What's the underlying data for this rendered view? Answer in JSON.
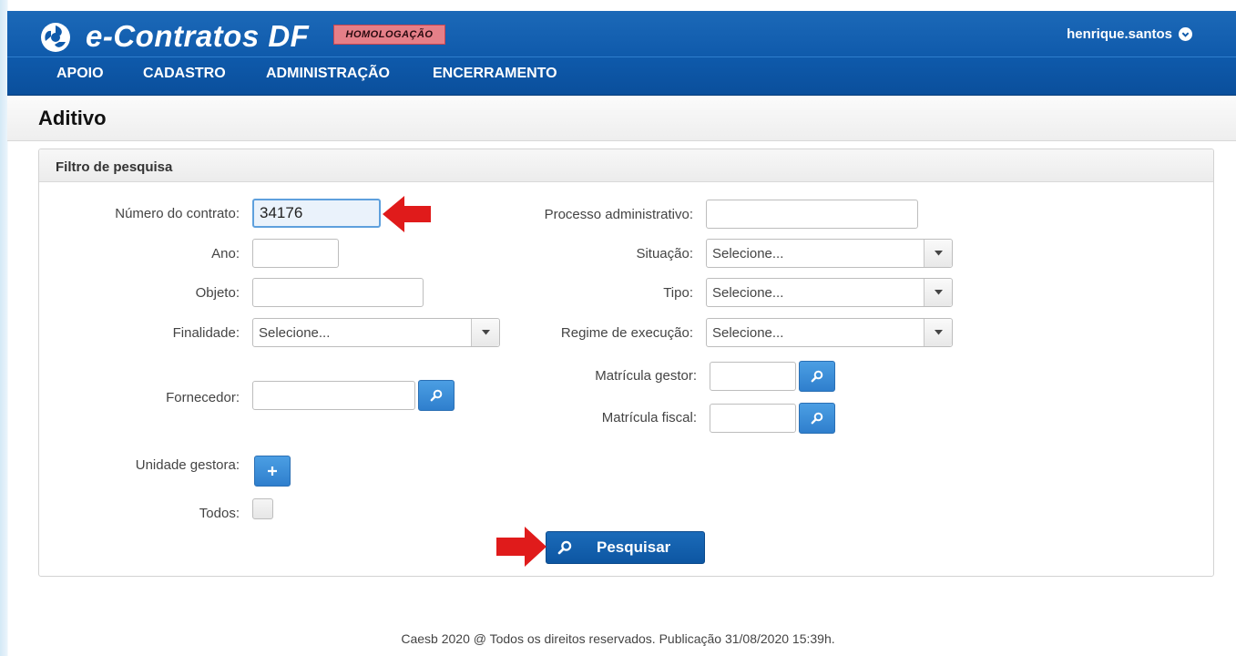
{
  "app": {
    "brand": "e-Contratos DF",
    "environment_badge": "HOMOLOGAÇÃO",
    "user": "henrique.santos"
  },
  "nav": {
    "items": [
      {
        "label": "APOIO"
      },
      {
        "label": "CADASTRO"
      },
      {
        "label": "ADMINISTRAÇÃO"
      },
      {
        "label": "ENCERRAMENTO"
      }
    ]
  },
  "page": {
    "title": "Aditivo"
  },
  "filter": {
    "panel_title": "Filtro de pesquisa",
    "numero_contrato": {
      "label": "Número do contrato:",
      "value": "34176"
    },
    "ano": {
      "label": "Ano:",
      "value": ""
    },
    "objeto": {
      "label": "Objeto:",
      "value": ""
    },
    "finalidade": {
      "label": "Finalidade:",
      "value": "Selecione..."
    },
    "fornecedor": {
      "label": "Fornecedor:",
      "value": ""
    },
    "unidade_gestora": {
      "label": "Unidade gestora:"
    },
    "todos": {
      "label": "Todos:",
      "checked": false
    },
    "processo_administrativo": {
      "label": "Processo administrativo:",
      "value": ""
    },
    "situacao": {
      "label": "Situação:",
      "value": "Selecione..."
    },
    "tipo": {
      "label": "Tipo:",
      "value": "Selecione..."
    },
    "regime_execucao": {
      "label": "Regime de execução:",
      "value": "Selecione..."
    },
    "matricula_gestor": {
      "label": "Matrícula gestor:",
      "value": ""
    },
    "matricula_fiscal": {
      "label": "Matrícula fiscal:",
      "value": ""
    },
    "search_button": "Pesquisar"
  },
  "footer": {
    "text": "Caesb 2020 @ Todos os direitos reservados. Publicação 31/08/2020 15:39h."
  },
  "colors": {
    "header_blue": "#0f5aab",
    "button_blue": "#1b6bb9",
    "badge_pink": "#e57f88",
    "annotation_arrow": "#e01b1b"
  }
}
